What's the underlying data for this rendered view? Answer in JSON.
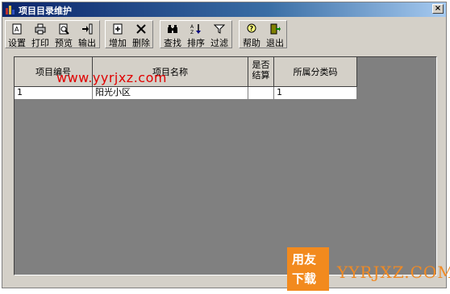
{
  "window": {
    "title": "项目目录维护",
    "close_glyph": "×"
  },
  "toolbar": {
    "buttons": [
      {
        "label": "设置",
        "icon": "settings-doc-icon"
      },
      {
        "label": "打印",
        "icon": "printer-icon"
      },
      {
        "label": "预览",
        "icon": "preview-icon"
      },
      {
        "label": "输出",
        "icon": "export-icon"
      },
      {
        "label": "增加",
        "icon": "add-icon"
      },
      {
        "label": "删除",
        "icon": "delete-icon"
      },
      {
        "label": "查找",
        "icon": "binoculars-icon"
      },
      {
        "label": "排序",
        "icon": "sort-az-icon"
      },
      {
        "label": "过滤",
        "icon": "filter-icon"
      },
      {
        "label": "帮助",
        "icon": "help-icon"
      },
      {
        "label": "退出",
        "icon": "exit-icon"
      }
    ]
  },
  "table": {
    "columns": [
      {
        "label": "项目编号"
      },
      {
        "label": "项目名称"
      },
      {
        "label_line1": "是否",
        "label_line2": "结算"
      },
      {
        "label": "所属分类码"
      }
    ],
    "rows": [
      {
        "code": "1",
        "name": "阳光小区",
        "settled": "",
        "category": "1"
      }
    ]
  },
  "watermark": {
    "url": "www.yyrjxz.com",
    "logo_top": "用友",
    "logo_bottom": "下载",
    "site": "YYRJXZ.COM",
    "colors": {
      "url": "#e00000",
      "logo": "#f28a1e"
    }
  }
}
